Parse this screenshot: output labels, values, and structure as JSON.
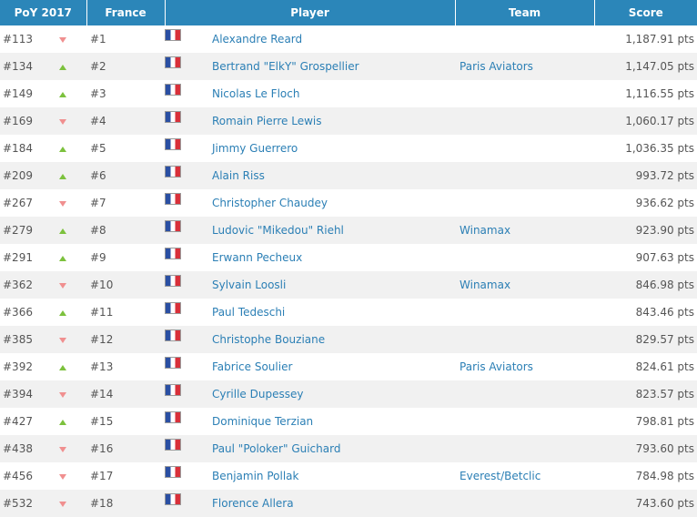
{
  "header": {
    "poy": "PoY 2017",
    "country": "France",
    "player": "Player",
    "team": "Team",
    "score": "Score"
  },
  "rows": [
    {
      "poy": "#113",
      "trend": "down",
      "rank": "#1",
      "flag": "france-flag-icon",
      "player": "Alexandre Reard",
      "team": "",
      "score": "1,187.91 pts"
    },
    {
      "poy": "#134",
      "trend": "up",
      "rank": "#2",
      "flag": "france-flag-icon",
      "player": "Bertrand \"ElkY\" Grospellier",
      "team": "Paris Aviators",
      "score": "1,147.05 pts"
    },
    {
      "poy": "#149",
      "trend": "up",
      "rank": "#3",
      "flag": "france-flag-icon",
      "player": "Nicolas Le Floch",
      "team": "",
      "score": "1,116.55 pts"
    },
    {
      "poy": "#169",
      "trend": "down",
      "rank": "#4",
      "flag": "france-flag-icon",
      "player": "Romain Pierre Lewis",
      "team": "",
      "score": "1,060.17 pts"
    },
    {
      "poy": "#184",
      "trend": "up",
      "rank": "#5",
      "flag": "france-flag-icon",
      "player": "Jimmy Guerrero",
      "team": "",
      "score": "1,036.35 pts"
    },
    {
      "poy": "#209",
      "trend": "up",
      "rank": "#6",
      "flag": "france-flag-icon",
      "player": "Alain Riss",
      "team": "",
      "score": "993.72 pts"
    },
    {
      "poy": "#267",
      "trend": "down",
      "rank": "#7",
      "flag": "france-flag-icon",
      "player": "Christopher Chaudey",
      "team": "",
      "score": "936.62 pts"
    },
    {
      "poy": "#279",
      "trend": "up",
      "rank": "#8",
      "flag": "france-flag-icon",
      "player": "Ludovic \"Mikedou\" Riehl",
      "team": "Winamax",
      "score": "923.90 pts"
    },
    {
      "poy": "#291",
      "trend": "up",
      "rank": "#9",
      "flag": "france-flag-icon",
      "player": "Erwann Pecheux",
      "team": "",
      "score": "907.63 pts"
    },
    {
      "poy": "#362",
      "trend": "down",
      "rank": "#10",
      "flag": "france-flag-icon",
      "player": "Sylvain Loosli",
      "team": "Winamax",
      "score": "846.98 pts"
    },
    {
      "poy": "#366",
      "trend": "up",
      "rank": "#11",
      "flag": "france-flag-icon",
      "player": "Paul Tedeschi",
      "team": "",
      "score": "843.46 pts"
    },
    {
      "poy": "#385",
      "trend": "down",
      "rank": "#12",
      "flag": "france-flag-icon",
      "player": "Christophe Bouziane",
      "team": "",
      "score": "829.57 pts"
    },
    {
      "poy": "#392",
      "trend": "up",
      "rank": "#13",
      "flag": "france-flag-icon",
      "player": "Fabrice Soulier",
      "team": "Paris Aviators",
      "score": "824.61 pts"
    },
    {
      "poy": "#394",
      "trend": "down",
      "rank": "#14",
      "flag": "france-flag-icon",
      "player": "Cyrille Dupessey",
      "team": "",
      "score": "823.57 pts"
    },
    {
      "poy": "#427",
      "trend": "up",
      "rank": "#15",
      "flag": "france-flag-icon",
      "player": "Dominique Terzian",
      "team": "",
      "score": "798.81 pts"
    },
    {
      "poy": "#438",
      "trend": "down",
      "rank": "#16",
      "flag": "france-flag-icon",
      "player": "Paul \"Poloker\" Guichard",
      "team": "",
      "score": "793.60 pts"
    },
    {
      "poy": "#456",
      "trend": "down",
      "rank": "#17",
      "flag": "france-flag-icon",
      "player": "Benjamin Pollak",
      "team": "Everest/Betclic",
      "score": "784.98 pts"
    },
    {
      "poy": "#532",
      "trend": "down",
      "rank": "#18",
      "flag": "france-flag-icon",
      "player": "Florence Allera",
      "team": "",
      "score": "743.60 pts"
    }
  ]
}
